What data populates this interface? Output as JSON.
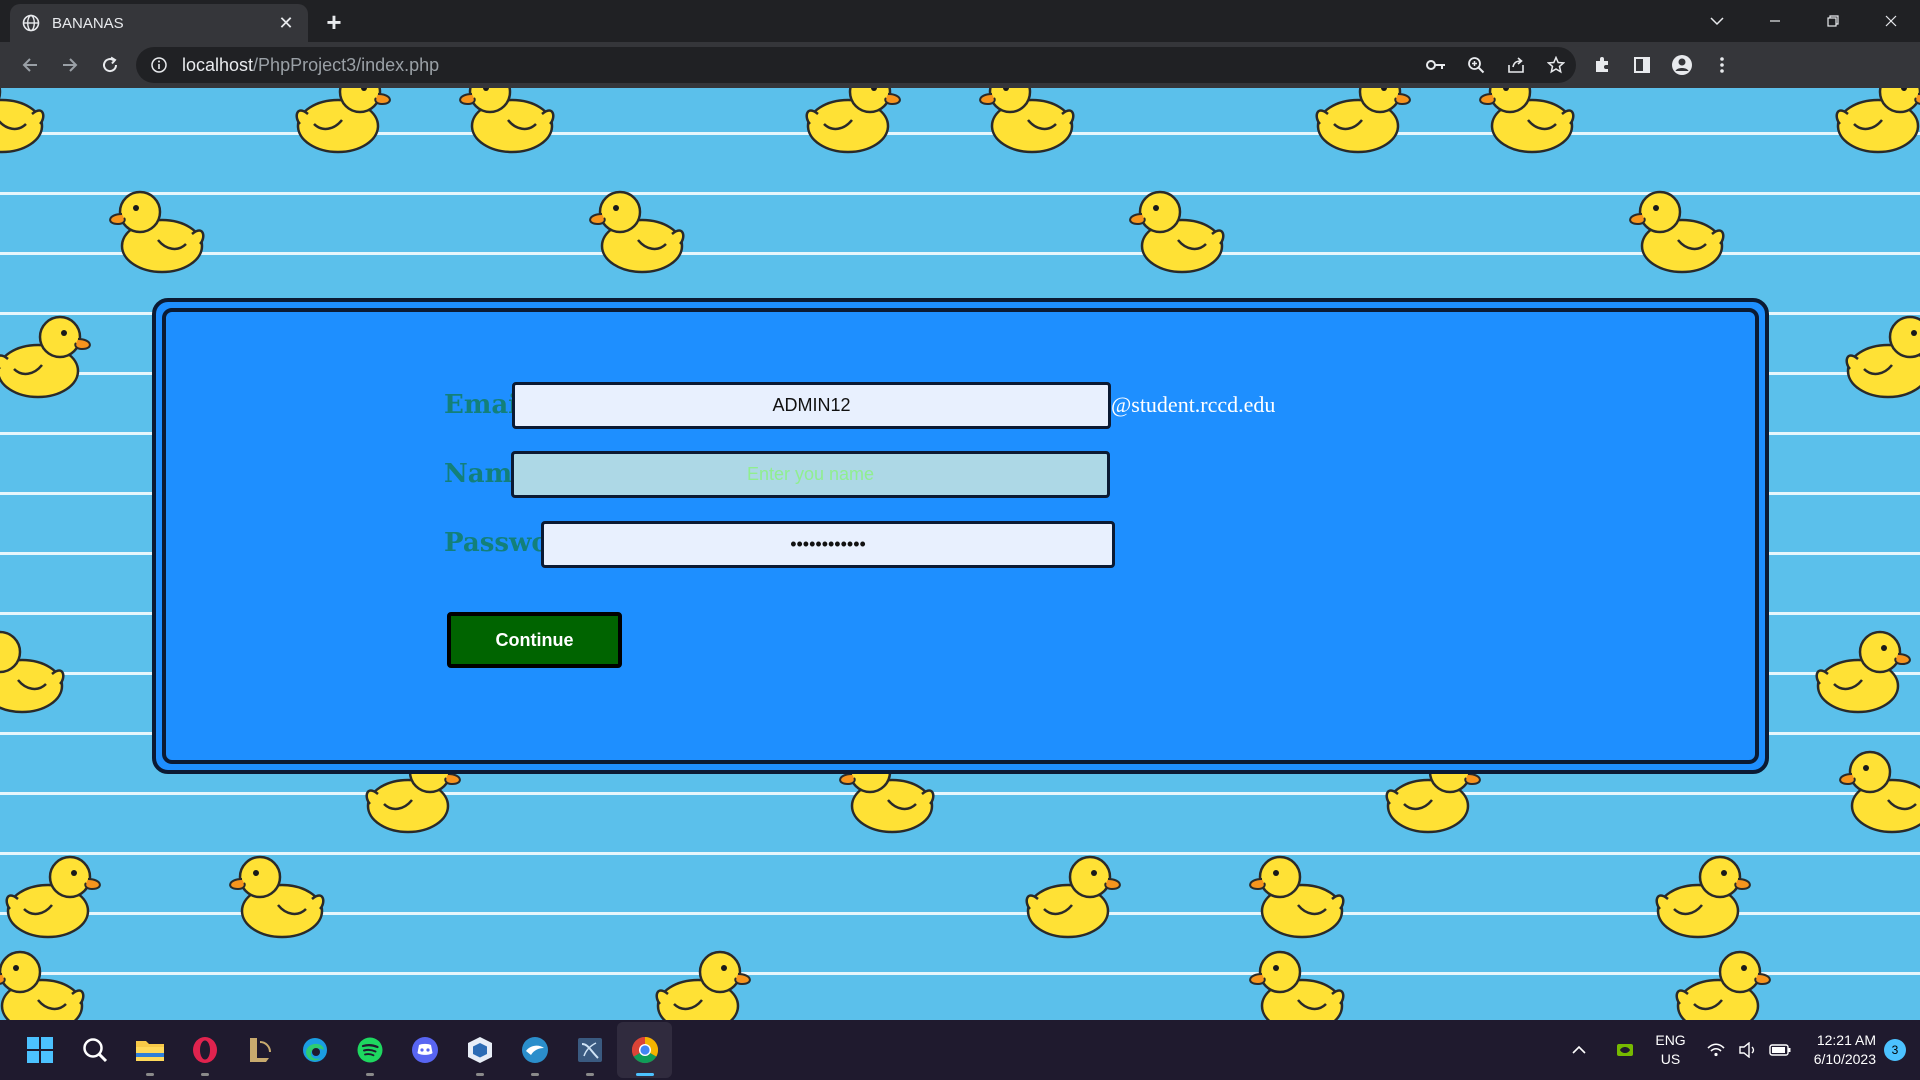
{
  "browser": {
    "tab_title": "BANANAS",
    "url_host": "localhost",
    "url_path": "/PhpProject3/index.php"
  },
  "form": {
    "email_label": "Email.",
    "email_value": "ADMIN12",
    "email_suffix": "@student.rccd.edu",
    "name_label": "Name.",
    "name_placeholder": "Enter you name",
    "password_label": "Password",
    "password_value": "••••••••••••",
    "continue_label": "Continue"
  },
  "taskbar": {
    "apps": [
      "start",
      "search",
      "file-explorer",
      "opera",
      "league-of-legends",
      "edge",
      "spotify",
      "discord",
      "virtualbox",
      "mysql-workbench-dolphin",
      "sql-tool",
      "chrome"
    ],
    "active_app": "chrome",
    "lang_line1": "ENG",
    "lang_line2": "US",
    "time": "12:21 AM",
    "date": "6/10/2023",
    "notification_count": "3"
  },
  "colors": {
    "page_bg": "#5bc0eb",
    "card_bg": "#1e8fff",
    "label_color": "#13807a",
    "button_bg": "#006400",
    "duck_body": "#ffe135",
    "duck_beak": "#f7941d"
  }
}
